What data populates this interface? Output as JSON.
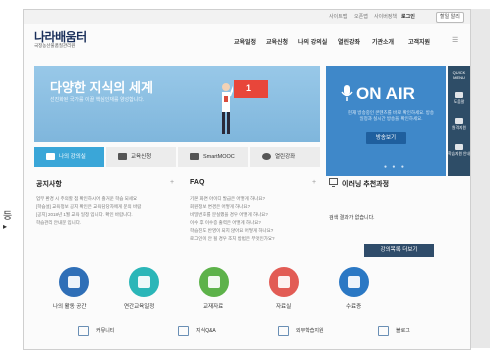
{
  "header": {
    "util_links": [
      "사이트맵",
      "오픈맵",
      "사이버정책"
    ],
    "login_label": "로그인",
    "util_button": "할일 알리"
  },
  "logo": {
    "name": "나라배움터",
    "sub": "국정농산물품질관리원"
  },
  "nav": [
    "교육일정",
    "교육신청",
    "나의 강의실",
    "열린강좌",
    "기관소개",
    "고객지원"
  ],
  "hero": {
    "title": "다양한 지식의 세계",
    "subtitle": "선진화된 국가를 이끌 핵심인재를 양성합니다.",
    "flag_text": "1"
  },
  "onair": {
    "title": "ON AIR",
    "subtitle": "현재 방송중인 콘텐츠를 바로 확인하세요. 방송일정과 실시간 방송을 확인하세요.",
    "button": "방송보기"
  },
  "quick_menu": {
    "title": "QUICK MENU",
    "items": [
      "도움말",
      "원격지원",
      "학습지원 안내"
    ]
  },
  "quick_buttons": [
    "나의 강의실",
    "교육신청",
    "SmartMOOC",
    "열린강좌"
  ],
  "sections": {
    "notice": {
      "title": "공지사항",
      "lines": [
        "업무 환경 시 주의할 점 확인하시어 즐거운 학습 되세요",
        "[학습설] 교육정보 공지 확인은 교육담당자에게 문의 바람",
        "[공지] 2018년 1월 교육 일정 입니다. 확인 바랍니다.",
        "학습관리 안내문 입니다."
      ]
    },
    "faq": {
      "title": "FAQ",
      "lines": [
        "기본 화면 아이디 발급은 어떻게 하나요?",
        "회원정보 변경은 어떻게 하나요?",
        "비밀번호를 분실했을 경우 어떻게 하나요?",
        "이수 후 이수증 출력은 어떻게 하나요?",
        "학습진도 반영이 되지 않아요 어떻게 하나요?",
        "로그인이 안 될 경우 조치 방법은 무엇인가요?"
      ]
    },
    "recommend": {
      "title": "이러닝 추천과정",
      "empty_message": "검색 결과가 없습니다.",
      "button": "강의목록 더보기"
    },
    "more": "+"
  },
  "circle_links": [
    {
      "label": "나의 활동 공간",
      "color": "#2f6fb7"
    },
    {
      "label": "연간교육일정",
      "color": "#2bb6b8"
    },
    {
      "label": "교재자료",
      "color": "#5db24a"
    },
    {
      "label": "자료실",
      "color": "#e25c55"
    },
    {
      "label": "수료증",
      "color": "#2b78c4"
    }
  ],
  "footer_links": [
    "커뮤니티",
    "지식Q&A",
    "외부학습지원",
    "블로그"
  ],
  "colors": {
    "hero_left": "#8cc0e2",
    "hero_right": "#3f88c9",
    "quick_menu": "#2e4d67",
    "navy": "#1a2f5a"
  }
}
